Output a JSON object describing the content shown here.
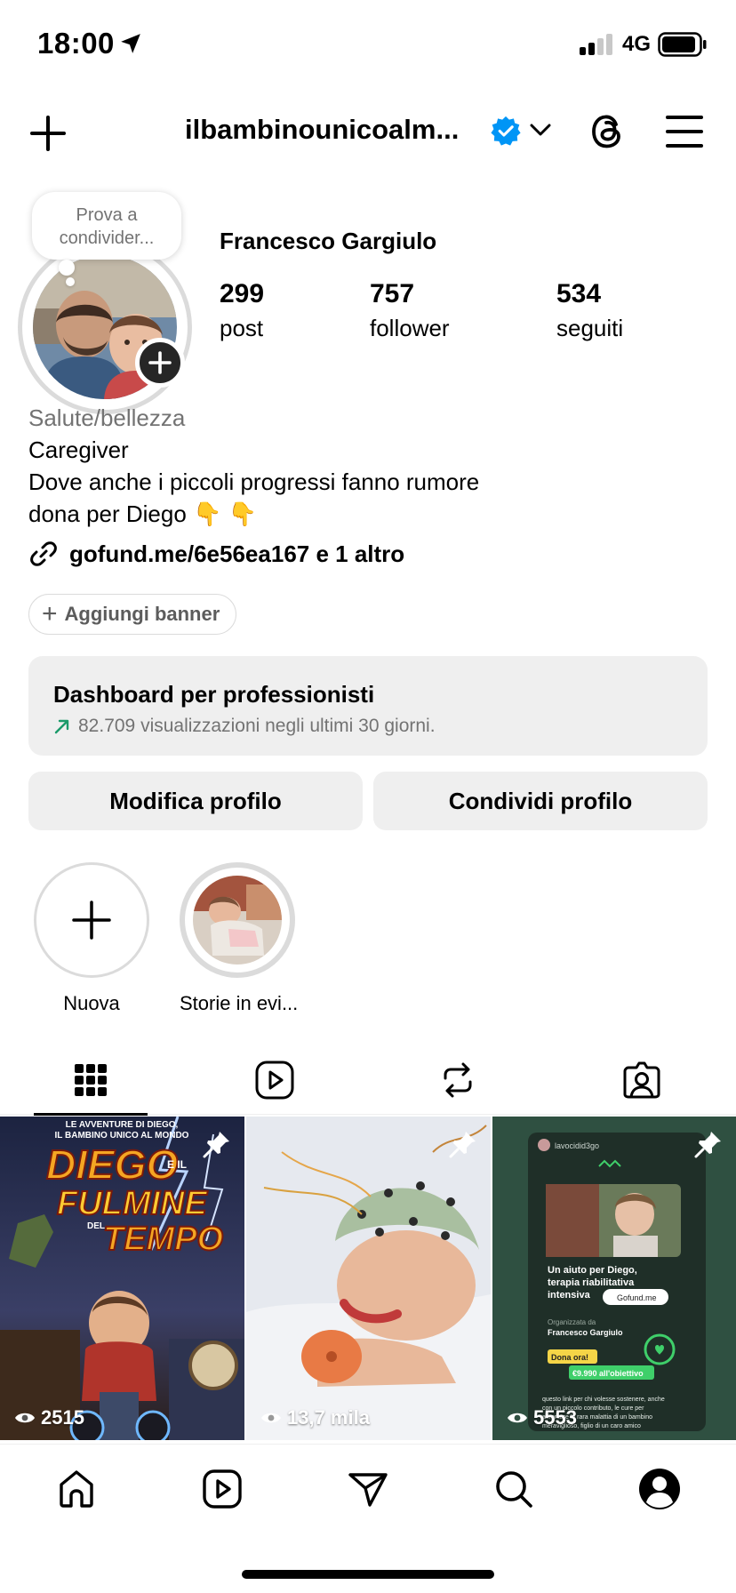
{
  "status_bar": {
    "time": "18:00",
    "network": "4G",
    "icons": [
      "location-arrow-icon",
      "signal-icon",
      "battery-icon"
    ]
  },
  "header": {
    "username": "ilbambinounicoalm...",
    "verified": true,
    "icons": [
      "plus-icon",
      "verified-badge-icon",
      "chevron-down-icon",
      "threads-icon",
      "menu-icon"
    ]
  },
  "note": {
    "text": "Prova a condivider..."
  },
  "profile": {
    "full_name": "Francesco Gargiulo",
    "stats": [
      {
        "value": "299",
        "label": "post"
      },
      {
        "value": "757",
        "label": "follower"
      },
      {
        "value": "534",
        "label": "seguiti"
      }
    ],
    "category": "Salute/bellezza",
    "bio_lines": [
      "Caregiver",
      "Dove anche i piccoli progressi fanno rumore",
      "dona per Diego 👇 👇"
    ],
    "link": "gofund.me/6e56ea167 e 1 altro"
  },
  "banner_button": "Aggiungi banner",
  "dashboard": {
    "title": "Dashboard per professionisti",
    "subtitle": "82.709 visualizzazioni negli ultimi 30 giorni.",
    "accent": "#1a9a6a"
  },
  "actions": {
    "edit": "Modifica profilo",
    "share": "Condividi profilo"
  },
  "highlights": [
    {
      "label": "Nuova"
    },
    {
      "label": "Storie in evi..."
    }
  ],
  "tabs": [
    "grid-icon",
    "reels-icon",
    "reposts-icon",
    "tagged-icon"
  ],
  "posts": [
    {
      "views": "2515",
      "pinned": true,
      "overlay_text": {
        "top": "LE AVVENTURE DI DIEGO,",
        "top2": "IL BAMBINO UNICO AL MONDO",
        "title1": "DIEGO",
        "title_small": "E IL",
        "title2": "FULMINE",
        "title_small2": "DEL",
        "title3": "TEMPO"
      }
    },
    {
      "views": "13,7 mila",
      "pinned": true
    },
    {
      "views": "5553",
      "pinned": true,
      "overlay_text": {
        "user": "lavocidid3go",
        "headline1": "Un aiuto per Diego,",
        "headline2": "terapia riabilitativa",
        "headline3": "intensiva",
        "gofund": "Gofund.me",
        "org_label": "Organizzata da",
        "org_name": "Francesco Gargiulo",
        "cta": "Dona ora!",
        "amount": "€9.990 all'obiettivo",
        "footer1": "questo link per chi volesse sostenere, anche",
        "footer2": "con un piccolo contributo, le cure per",
        "footer3": "affrontare la rara malattia di un bambino",
        "footer4": "meraviglioso, figlio di un caro amico"
      }
    }
  ],
  "bottom_nav": [
    "home-icon",
    "reels-icon",
    "messages-icon",
    "search-icon",
    "profile-icon"
  ]
}
